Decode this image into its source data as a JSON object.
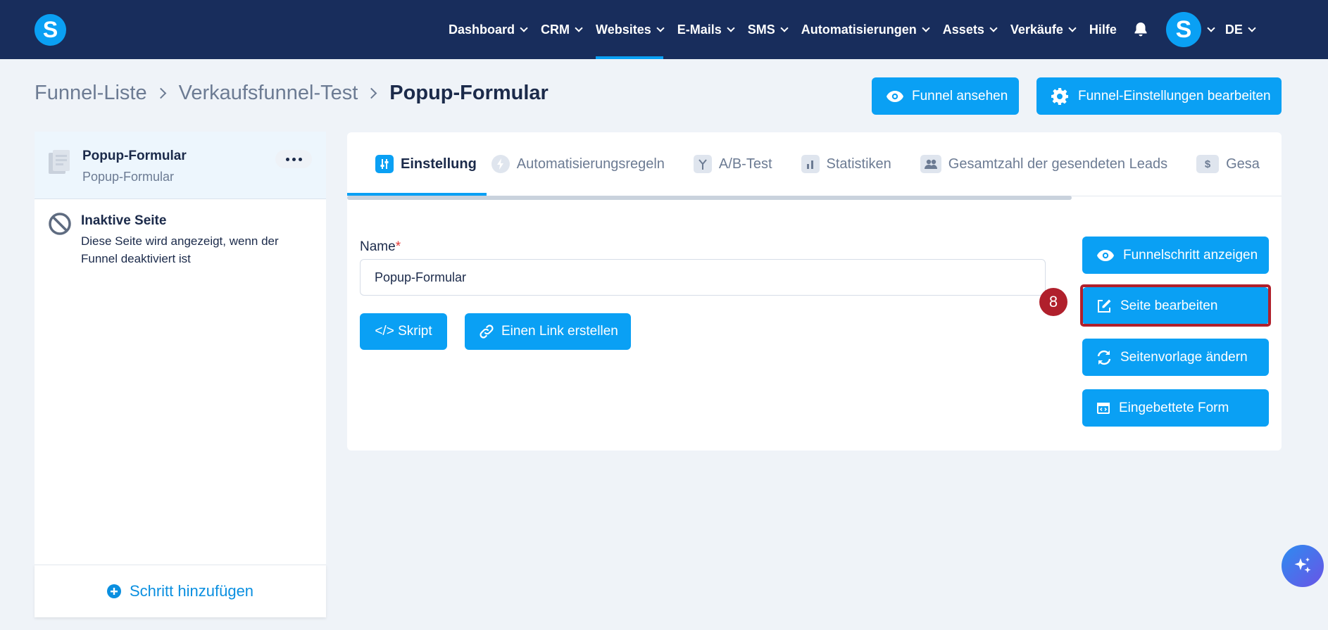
{
  "nav": {
    "items": [
      {
        "label": "Dashboard"
      },
      {
        "label": "CRM"
      },
      {
        "label": "Websites"
      },
      {
        "label": "E-Mails"
      },
      {
        "label": "SMS"
      },
      {
        "label": "Automatisierungen"
      },
      {
        "label": "Assets"
      },
      {
        "label": "Verkäufe"
      }
    ],
    "help": "Hilfe",
    "avatar_letter": "S",
    "language": "DE",
    "logo_letter": "S",
    "active_item": "Websites"
  },
  "breadcrumb": {
    "items": [
      "Funnel-Liste",
      "Verkaufsfunnel-Test"
    ],
    "current": "Popup-Formular"
  },
  "header_actions": {
    "view_funnel": "Funnel ansehen",
    "edit_settings": "Funnel-Einstellungen bearbeiten"
  },
  "sidebar": {
    "active_step": {
      "title": "Popup-Formular",
      "subtitle": "Popup-Formular"
    },
    "inactive_page": {
      "title": "Inaktive Seite",
      "description": "Diese Seite wird angezeigt, wenn der Funnel deaktiviert ist"
    },
    "add_step": "Schritt hinzufügen"
  },
  "tabs": [
    {
      "label": "Einstellung",
      "icon": "sliders-icon",
      "active": true
    },
    {
      "label": "Automatisierungsregeln",
      "icon": "bolt-icon"
    },
    {
      "label": "A/B-Test",
      "icon": "split-icon"
    },
    {
      "label": "Statistiken",
      "icon": "bar-chart-icon"
    },
    {
      "label": "Gesamtzahl der gesendeten Leads",
      "icon": "users-icon"
    },
    {
      "label": "Gesa",
      "icon": "dollar-icon"
    }
  ],
  "form": {
    "name_label": "Name",
    "required_mark": "*",
    "name_value": "Popup-Formular",
    "script_button": "</> Skript",
    "link_button": "Einen Link erstellen"
  },
  "actions": {
    "view_step": "Funnelschritt anzeigen",
    "edit_page": "Seite bearbeiten",
    "change_template": "Seitenvorlage ändern",
    "embedded_form": "Eingebettete Form"
  },
  "annotation": {
    "step_number": "8"
  },
  "colors": {
    "nav_bg": "#182d5c",
    "accent": "#0aa0f4",
    "highlight": "#b0202c"
  }
}
